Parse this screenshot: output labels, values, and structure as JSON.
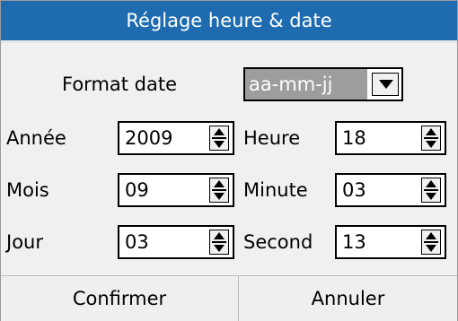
{
  "dialog": {
    "title": "Réglage heure & date",
    "format_label": "Format date",
    "format_value": "aa-mm-jj"
  },
  "fields": {
    "annee": {
      "label": "Année",
      "value": "2009"
    },
    "mois": {
      "label": "Mois",
      "value": "09"
    },
    "jour": {
      "label": "Jour",
      "value": "03"
    },
    "heure": {
      "label": "Heure",
      "value": "18"
    },
    "minute": {
      "label": "Minute",
      "value": "03"
    },
    "second": {
      "label": "Second",
      "value": "13"
    }
  },
  "buttons": {
    "confirm": "Confirmer",
    "cancel": "Annuler"
  },
  "colors": {
    "title_bar": "#1e6bb0",
    "background": "#f0f0f0",
    "selected_value": "#9d9d9d"
  },
  "icons": {
    "dropdown": "chevron-down-icon",
    "spinner": "spinner-up-down-icon"
  }
}
